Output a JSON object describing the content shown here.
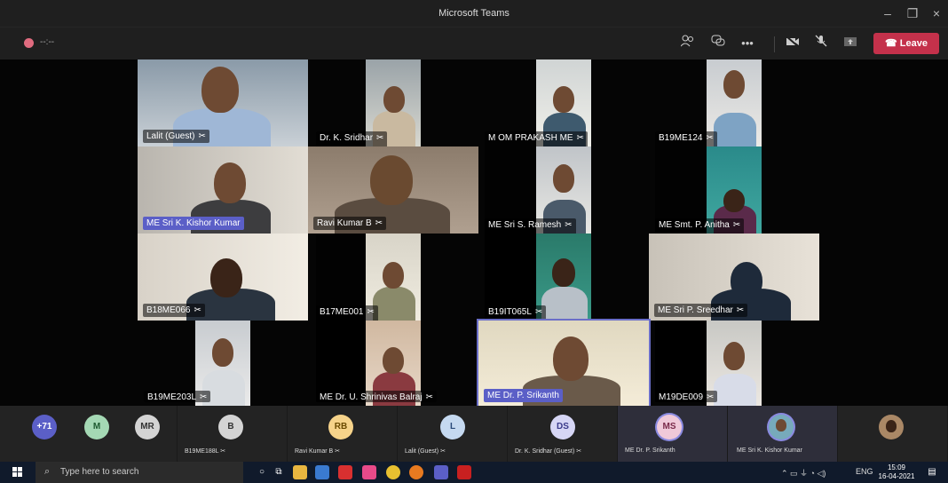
{
  "window": {
    "title": "Microsoft Teams"
  },
  "toolbar": {
    "rec_time": "--:--",
    "leave_label": "Leave"
  },
  "tiles": [
    {
      "name": "Lalit (Guest)"
    },
    {
      "name": "Dr. K. Sridhar"
    },
    {
      "name": "M OM PRAKASH ME"
    },
    {
      "name": "B19ME124"
    },
    {
      "name": "ME Sri K. Kishor Kumar"
    },
    {
      "name": "Ravi Kumar B"
    },
    {
      "name": "ME Sri S. Ramesh"
    },
    {
      "name": "ME Smt. P. Anitha"
    },
    {
      "name": "B18ME066"
    },
    {
      "name": "B17ME001"
    },
    {
      "name": "B19IT065L"
    },
    {
      "name": "ME Sri P. Sreedhar"
    },
    {
      "name": "B19ME203L"
    },
    {
      "name": "ME Dr. U. Shrinivas Balraj"
    },
    {
      "name": "ME Dr. P. Srikanth"
    },
    {
      "name": "M19DE009"
    }
  ],
  "strip": [
    {
      "initials": "+71",
      "name": "",
      "color": "#5b5fc7"
    },
    {
      "initials": "M",
      "name": "",
      "color": "#a4d8b4"
    },
    {
      "initials": "MR",
      "name": "",
      "color": "#d4d4d4"
    },
    {
      "initials": "B",
      "name": "B19ME188L",
      "color": "#d4d4d4"
    },
    {
      "initials": "RB",
      "name": "Ravi Kumar B",
      "color": "#f6d38a"
    },
    {
      "initials": "L",
      "name": "Lalit (Guest)",
      "color": "#c5d9f0"
    },
    {
      "initials": "DS",
      "name": "Dr. K. Sridhar (Guest)",
      "color": "#d6d6f5"
    },
    {
      "initials": "MS",
      "name": "ME Dr. P. Srikanth",
      "color": "#f0c9d9"
    },
    {
      "initials": "",
      "name": "ME Sri K. Kishor Kumar",
      "color": "#7ab"
    },
    {
      "initials": "",
      "name": "",
      "color": "#a86"
    }
  ],
  "taskbar": {
    "search_placeholder": "Type here to search",
    "lang": "ENG",
    "time": "15:09",
    "date": "16-04-2021"
  }
}
